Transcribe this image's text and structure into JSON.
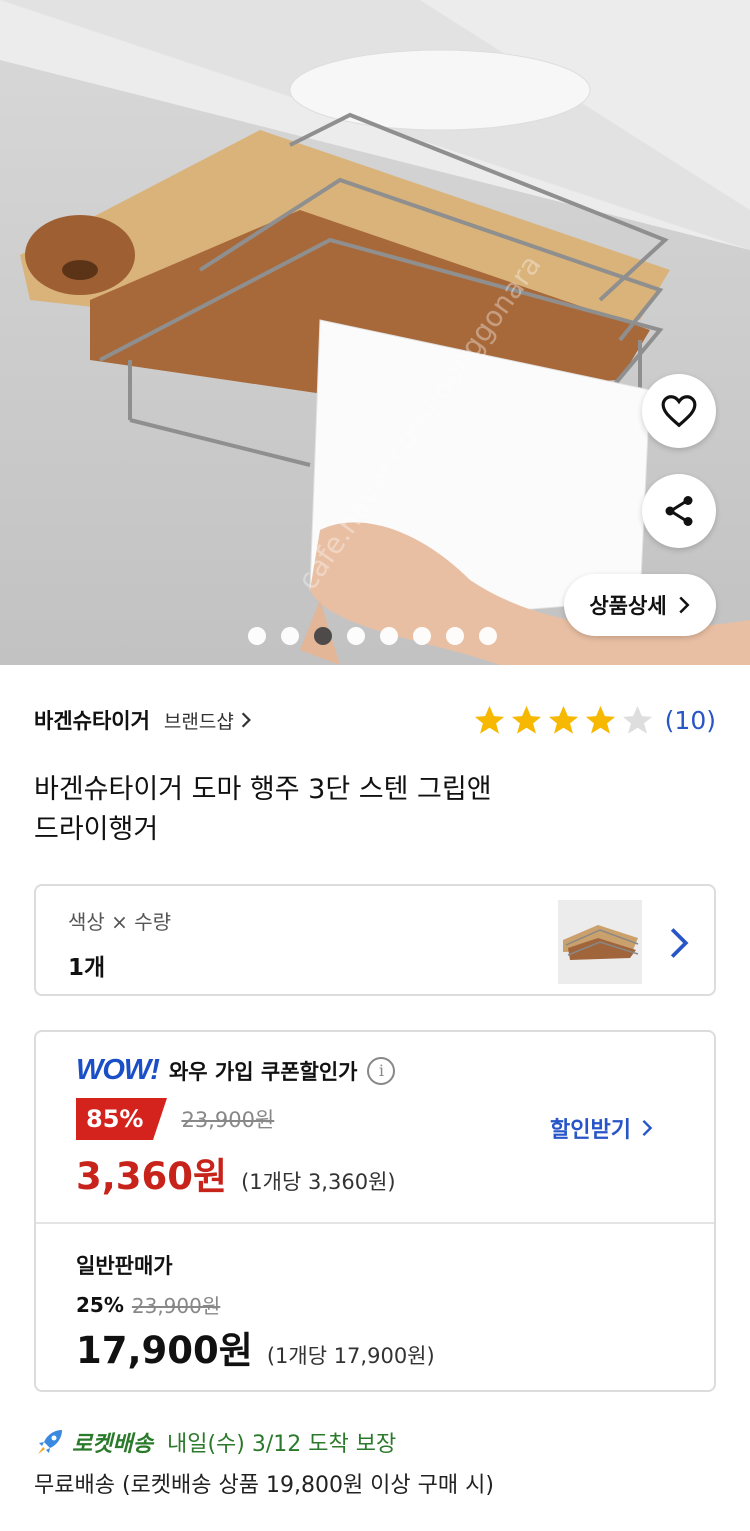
{
  "product_image": {
    "watermark": "cafe.naver.com/joonggonara",
    "carousel": {
      "total": 8,
      "active": 3
    },
    "detail_button_label": "상품상세"
  },
  "brand": {
    "name": "바겐슈타이거",
    "shop_link": "브랜드샵"
  },
  "rating": {
    "stars": 4,
    "max": 5,
    "count": "(10)",
    "star_color": "#f6b800"
  },
  "product": {
    "title_line1": "바겐슈타이거 도마 행주 3단 스텐 그립앤",
    "title_line2": "드라이행거"
  },
  "option": {
    "label": "색상 × 수량",
    "value": "1개"
  },
  "pricing": {
    "wow": {
      "logo": "WOW!",
      "label": "와우 가입 쿠폰할인가",
      "discount": "85%",
      "original": "23,900원",
      "price": "3,360원",
      "unit": "(1개당 3,360원)",
      "coupon_link": "할인받기"
    },
    "normal": {
      "label": "일반판매가",
      "discount": "25%",
      "original": "23,900원",
      "price": "17,900원",
      "unit": "(1개당 17,900원)"
    }
  },
  "delivery": {
    "rocket_label": "로켓배송",
    "arrival": "내일(수) 3/12 도착 보장",
    "free_shipping": "무료배송 (로켓배송 상품 19,800원 이상 구매 시)"
  },
  "colors": {
    "accent_blue": "#2856c8",
    "sale_red": "#c8231b",
    "rocket_green": "#2b7a2b"
  }
}
